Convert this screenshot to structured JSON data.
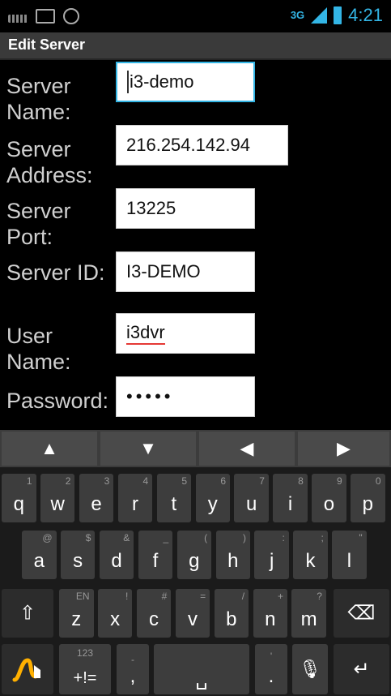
{
  "status_bar": {
    "network": "3G",
    "time": "4:21"
  },
  "title": "Edit Server",
  "form": {
    "fields": [
      {
        "label": "Server Name:",
        "value": "i3-demo"
      },
      {
        "label": "Server Address:",
        "value": "216.254.142.94"
      },
      {
        "label": "Server Port:",
        "value": "13225"
      },
      {
        "label": "Server ID:",
        "value": "I3-DEMO"
      },
      {
        "label": "User Name:",
        "value": "i3dvr"
      },
      {
        "label": "Password:",
        "value": "•••••"
      }
    ]
  },
  "keyboard": {
    "row1": [
      {
        "key": "q",
        "hint": "1"
      },
      {
        "key": "w",
        "hint": "2"
      },
      {
        "key": "e",
        "hint": "3"
      },
      {
        "key": "r",
        "hint": "4"
      },
      {
        "key": "t",
        "hint": "5"
      },
      {
        "key": "y",
        "hint": "6"
      },
      {
        "key": "u",
        "hint": "7"
      },
      {
        "key": "i",
        "hint": "8"
      },
      {
        "key": "o",
        "hint": "9"
      },
      {
        "key": "p",
        "hint": "0"
      }
    ],
    "row2": [
      {
        "key": "a",
        "hint": "@"
      },
      {
        "key": "s",
        "hint": "$"
      },
      {
        "key": "d",
        "hint": "&"
      },
      {
        "key": "f",
        "hint": "_"
      },
      {
        "key": "g",
        "hint": "("
      },
      {
        "key": "h",
        "hint": ")"
      },
      {
        "key": "j",
        "hint": ":"
      },
      {
        "key": "k",
        "hint": ";"
      },
      {
        "key": "l",
        "hint": "\""
      }
    ],
    "row3": [
      {
        "key": "z",
        "hint": "EN"
      },
      {
        "key": "x",
        "hint": "!"
      },
      {
        "key": "c",
        "hint": "#"
      },
      {
        "key": "v",
        "hint": "="
      },
      {
        "key": "b",
        "hint": "/"
      },
      {
        "key": "n",
        "hint": "+"
      },
      {
        "key": "m",
        "hint": "?"
      }
    ],
    "symbols_key": "+!=",
    "symbols_hint": "123",
    "comma": ",",
    "comma_hint": "-",
    "period": ".",
    "period_hint": "'"
  }
}
